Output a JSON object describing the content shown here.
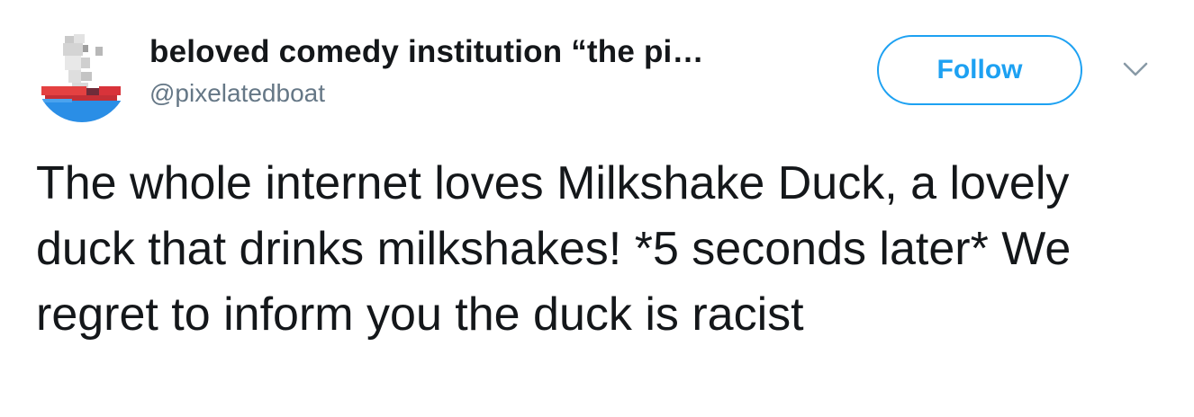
{
  "tweet": {
    "avatar": {
      "icon": "pixel-boat-icon",
      "colors": {
        "sea": "#2a8ee6",
        "hull": "#e23b3b",
        "sail": "#bdbdbd"
      }
    },
    "display_name": "beloved comedy institution “the pi…",
    "handle": "@pixelatedboat",
    "follow_label": "Follow",
    "more_icon": "chevron-down-icon",
    "text": "The whole internet loves Milkshake Duck, a lovely duck that drinks milkshakes! *5 seconds later* We regret to inform you the duck is racist"
  },
  "colors": {
    "accent": "#1da1f2",
    "text": "#14171a",
    "secondary": "#657786",
    "caret": "#8899a6"
  }
}
